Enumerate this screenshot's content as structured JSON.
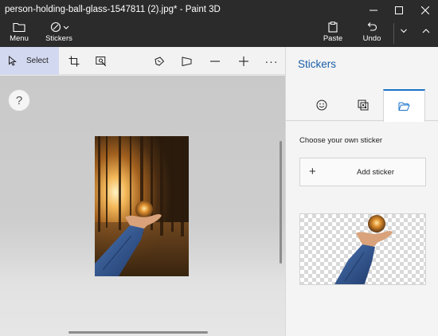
{
  "window": {
    "title": "person-holding-ball-glass-1547811 (2).jpg* - Paint 3D"
  },
  "ribbon": {
    "menu_label": "Menu",
    "stickers_label": "Stickers",
    "paste_label": "Paste",
    "undo_label": "Undo"
  },
  "toolbar": {
    "select_label": "Select",
    "more_label": "···"
  },
  "canvas": {
    "help_label": "?"
  },
  "panel": {
    "title": "Stickers",
    "choose_label": "Choose your own sticker",
    "add_sticker_label": "Add sticker",
    "add_plus": "+"
  },
  "colors": {
    "titlebar": "#2b2b2b",
    "accent": "#1a73c8",
    "panel_title": "#1a5fa8",
    "select_highlight": "#d2d8ef"
  }
}
